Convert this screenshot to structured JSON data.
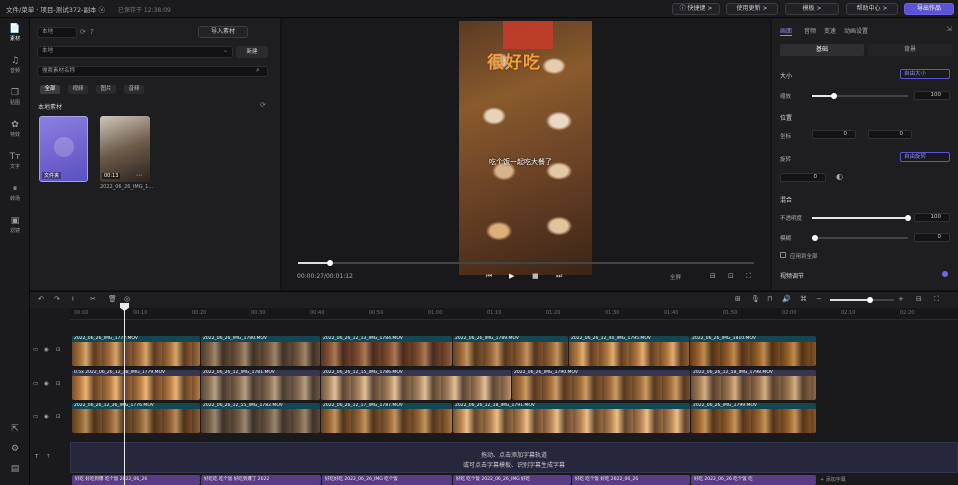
{
  "titlebar": {
    "title": "文件/菜单 · 项目-测试372-副本 ⓥ",
    "autosave": "已保存于 12:38:09",
    "buttons": [
      "ⓘ 快捷键 >",
      "使用更新 >",
      "模板 >",
      "帮助中心 >",
      "导出作品"
    ]
  },
  "left_rail": [
    {
      "icon": "📄",
      "label": "素材"
    },
    {
      "icon": "♫",
      "label": "音频"
    },
    {
      "icon": "❐",
      "label": "贴图"
    },
    {
      "icon": "✿",
      "label": "特效"
    },
    {
      "icon": "Tт",
      "label": "文字"
    },
    {
      "icon": "⏸",
      "label": "转场"
    },
    {
      "icon": "▣",
      "label": "滤镜"
    }
  ],
  "media_panel": {
    "source_select": "本地",
    "upload_button": "导入素材",
    "folder_select": "本地",
    "folder_action": "新建",
    "search_placeholder": "搜索素材名称",
    "filters": [
      "全部",
      "视频",
      "图片",
      "音频"
    ],
    "section_label": "本地素材",
    "items": [
      {
        "badge": "已添加",
        "name": "文件夹"
      },
      {
        "badge": "00:13",
        "name": "2022_06_26_IMG_1..."
      }
    ]
  },
  "player": {
    "caption_top": "很好吃",
    "caption_mid": "吃个饭一起吃大餐了",
    "time": "00:00:27/00:01:12",
    "zoom": "全屏"
  },
  "props_panel": {
    "tabs": [
      "画面",
      "音频",
      "变速",
      "动画设置"
    ],
    "subtabs": [
      "基础",
      "背景"
    ],
    "size_label": "大小",
    "size_mode": "自由大小",
    "scale_label": "缩放",
    "scale_value": "100",
    "pos_label": "位置",
    "pos_sub": "坐标",
    "x_value": "0",
    "y_value": "0",
    "rotate_label": "旋转",
    "rotate_mode": "自由旋转",
    "rotate_value": "0",
    "mix_label": "混合",
    "opacity_label": "不透明度",
    "opacity_value": "100",
    "opacity_level": 1.0,
    "blur_label": "模糊",
    "blur_value": "0",
    "blur_level": 0.0,
    "check_label": "应用到全部",
    "adv_label": "视频调节"
  },
  "timeline": {
    "ruler": [
      "00:00",
      "00:10",
      "00:20",
      "00:30",
      "00:40",
      "00:50",
      "01:00",
      "01:10",
      "01:20",
      "01:30",
      "01:40",
      "01:50",
      "02:00",
      "02:10",
      "02:20"
    ],
    "track1_clips": [
      {
        "label": "2022_06_26_IMG_1777.MOV"
      },
      {
        "label": "2022_06_26_IMG_1780.MOV"
      },
      {
        "label": "2022_06_26_12_13_IMG_1784.MOV"
      },
      {
        "label": "2022_06_26_IMG_1789.MOV"
      },
      {
        "label": "2022_06_26_12_40_IMG_1795.MOV"
      },
      {
        "label": "2022_06_26_IMG_1810.MOV"
      }
    ],
    "track2_clips": [
      {
        "label": "0.5x 2022_06_26_12_38_IMG_1779.MOV"
      },
      {
        "label": "2022_06_26_12_IMG_1781.MOV"
      },
      {
        "label": "2022_06_26_12_15_IMG_1786.MOV"
      },
      {
        "label": "2022_06_26_IMG_1790.MOV"
      },
      {
        "label": "2022_06_26_12_58_IMG_1798.MOV"
      }
    ],
    "track3_clips": [
      {
        "label": "2022_06_26_12_36_IMG_1776.MOV"
      },
      {
        "label": "2022_06_26_12_55_IMG_1782.MOV"
      },
      {
        "label": "2022_06_26_12_17_IMG_1787.MOV"
      },
      {
        "label": "2022_06_26_12_18_IMG_1791.MOV"
      },
      {
        "label": "2022_06_26_IMG_1799.MOV"
      }
    ],
    "subtitle_hint_1": "拖动、点击添加字幕轨道",
    "subtitle_hint_2": "或可点击字幕模板、识别字幕生成字幕",
    "subtitle_clips": [
      "好吃 好吃到爆 吃个饭 2022_06_26",
      "好吃吃 吃个饭 好吃到爆了 2022",
      "好吃好吃 2022_06_26_IMG 吃个饭",
      "好吃 吃个饭 2022_06_26_IMG 好吃",
      "好吃 吃个饭 好吃 2022_06_26",
      "好吃 2022_06_26 吃个饭 吃"
    ],
    "subtitle_extra": "+ 添加字幕"
  }
}
